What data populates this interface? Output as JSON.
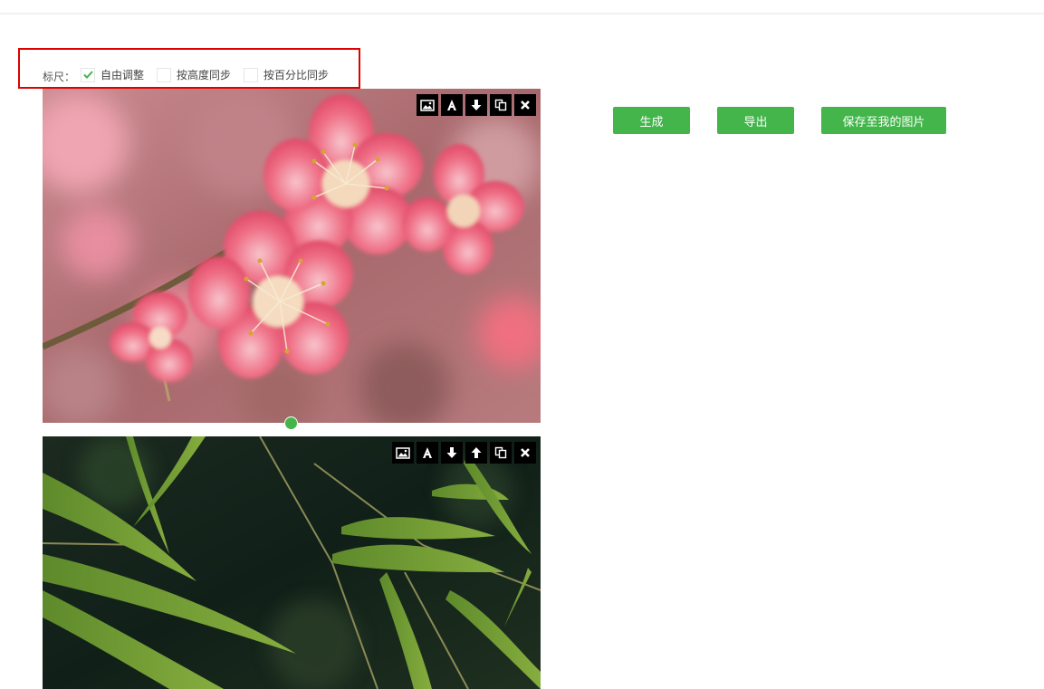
{
  "ruler": {
    "label": "标尺：",
    "options": [
      {
        "label": "自由调整",
        "checked": true
      },
      {
        "label": "按高度同步",
        "checked": false
      },
      {
        "label": "按百分比同步",
        "checked": false
      }
    ]
  },
  "actions": {
    "generate_label": "生成",
    "export_label": "导出",
    "save_label": "保存至我的图片"
  },
  "images": [
    {
      "toolbar": [
        "image-icon",
        "text-icon",
        "arrow-down-icon",
        "copy-icon",
        "close-icon"
      ]
    },
    {
      "toolbar": [
        "image-icon",
        "text-icon",
        "arrow-down-icon",
        "arrow-up-icon",
        "copy-icon",
        "close-icon"
      ]
    }
  ],
  "colors": {
    "accent": "#43b54a",
    "highlight_border": "#e00000",
    "toolbar_bg": "#000000"
  }
}
